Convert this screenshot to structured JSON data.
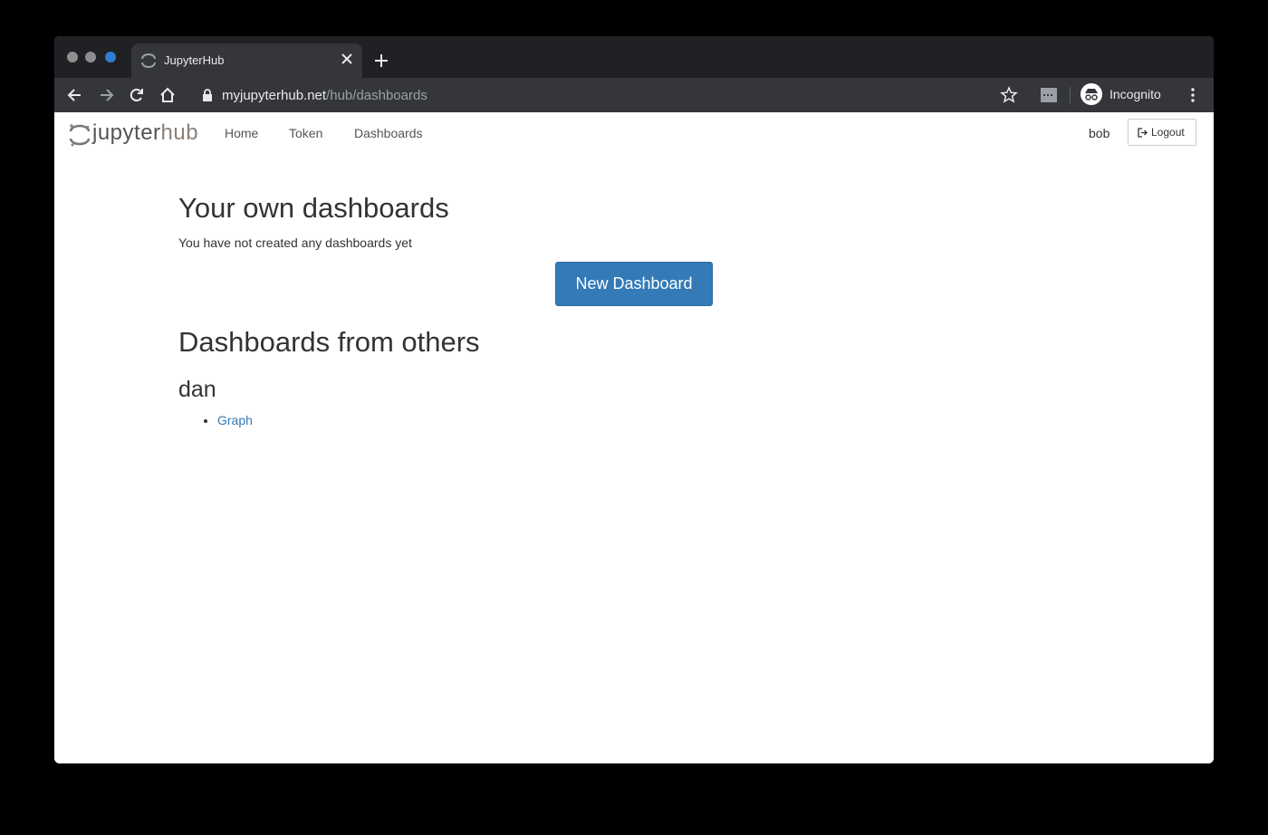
{
  "browser": {
    "tab_title": "JupyterHub",
    "url_host": "myjupyterhub.net",
    "url_path": "/hub/dashboards",
    "profile_label": "Incognito",
    "icons": [
      "back-icon",
      "forward-icon",
      "reload-icon",
      "home-icon",
      "lock-icon",
      "star-icon",
      "extension-icon",
      "incognito-icon",
      "menu-icon",
      "close-icon",
      "plus-icon"
    ]
  },
  "navbar": {
    "logo_main": "jupyter",
    "logo_hub": "hub",
    "links": [
      {
        "label": "Home"
      },
      {
        "label": "Token"
      },
      {
        "label": "Dashboards"
      }
    ],
    "user": "bob",
    "logout_label": "Logout"
  },
  "main": {
    "own_heading": "Your own dashboards",
    "own_empty_message": "You have not created any dashboards yet",
    "new_button_label": "New Dashboard",
    "others_heading": "Dashboards from others",
    "others": [
      {
        "user": "dan",
        "dashboards": [
          "Graph"
        ]
      }
    ]
  },
  "colors": {
    "primary": "#337ab7",
    "browser_chrome": "#35363a",
    "tab_strip": "#202124"
  }
}
